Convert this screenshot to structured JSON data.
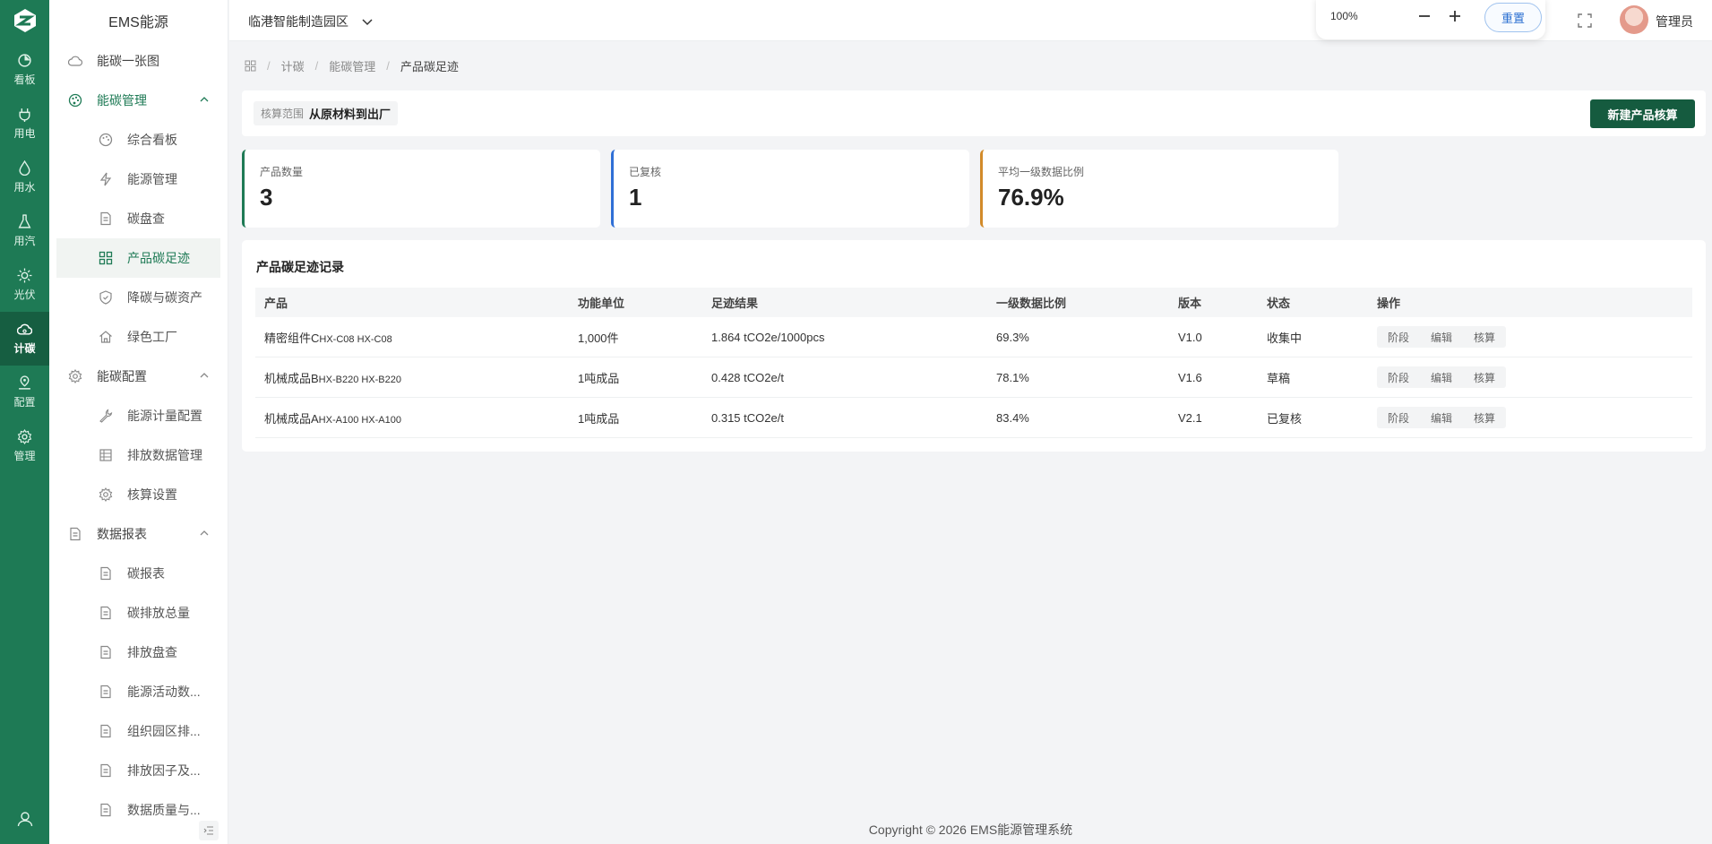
{
  "rail": {
    "items": [
      {
        "label": "看板",
        "icon": "pie-chart-icon"
      },
      {
        "label": "用电",
        "icon": "plug-icon"
      },
      {
        "label": "用水",
        "icon": "water-drop-icon"
      },
      {
        "label": "用汽",
        "icon": "flask-icon"
      },
      {
        "label": "光伏",
        "icon": "sun-icon"
      },
      {
        "label": "计碳",
        "icon": "cloud-icon",
        "active": true
      },
      {
        "label": "配置",
        "icon": "location-pin-icon"
      },
      {
        "label": "管理",
        "icon": "gear-icon"
      }
    ]
  },
  "sidebar": {
    "title": "EMS能源",
    "items": [
      {
        "label": "能碳一张图"
      },
      {
        "label": "能碳管理"
      },
      {
        "label": "综合看板"
      },
      {
        "label": "能源管理"
      },
      {
        "label": "碳盘查"
      },
      {
        "label": "产品碳足迹"
      },
      {
        "label": "降碳与碳资产"
      },
      {
        "label": "绿色工厂"
      },
      {
        "label": "能碳配置"
      },
      {
        "label": "能源计量配置"
      },
      {
        "label": "排放数据管理"
      },
      {
        "label": "核算设置"
      },
      {
        "label": "数据报表"
      },
      {
        "label": "碳报表"
      },
      {
        "label": "碳排放总量"
      },
      {
        "label": "排放盘查"
      },
      {
        "label": "能源活动数..."
      },
      {
        "label": "组织园区排..."
      },
      {
        "label": "排放因子及..."
      },
      {
        "label": "数据质量与..."
      }
    ]
  },
  "header": {
    "site": "临港智能制造园区",
    "zoom": "100%",
    "reset_label": "重置",
    "user": "管理员"
  },
  "breadcrumb": {
    "items": [
      "计碳",
      "能碳管理",
      "产品碳足迹"
    ]
  },
  "scope": {
    "label": "核算范围",
    "value": "从原材料到出厂",
    "new_button": "新建产品核算"
  },
  "stats": [
    {
      "label": "产品数量",
      "value": "3",
      "color": "#1e7a55"
    },
    {
      "label": "已复核",
      "value": "1",
      "color": "#2f6fd6"
    },
    {
      "label": "平均一级数据比例",
      "value": "76.9%",
      "color": "#d28b2a"
    }
  ],
  "records": {
    "title": "产品碳足迹记录",
    "columns": [
      "产品",
      "功能单位",
      "足迹结果",
      "一级数据比例",
      "版本",
      "状态",
      "操作"
    ],
    "rows": [
      {
        "product": "精密组件C",
        "code": "HX-C08 HX-C08",
        "unit": "1,000件",
        "result": "1.864 tCO2e/1000pcs",
        "ratio": "69.3%",
        "version": "V1.0",
        "status": "收集中"
      },
      {
        "product": "机械成品B",
        "code": "HX-B220 HX-B220",
        "unit": "1吨成品",
        "result": "0.428 tCO2e/t",
        "ratio": "78.1%",
        "version": "V1.6",
        "status": "草稿"
      },
      {
        "product": "机械成品A",
        "code": "HX-A100 HX-A100",
        "unit": "1吨成品",
        "result": "0.315 tCO2e/t",
        "ratio": "83.4%",
        "version": "V2.1",
        "status": "已复核"
      }
    ],
    "actions": [
      "阶段",
      "编辑",
      "核算"
    ]
  },
  "footer": "Copyright © 2026 EMS能源管理系统"
}
